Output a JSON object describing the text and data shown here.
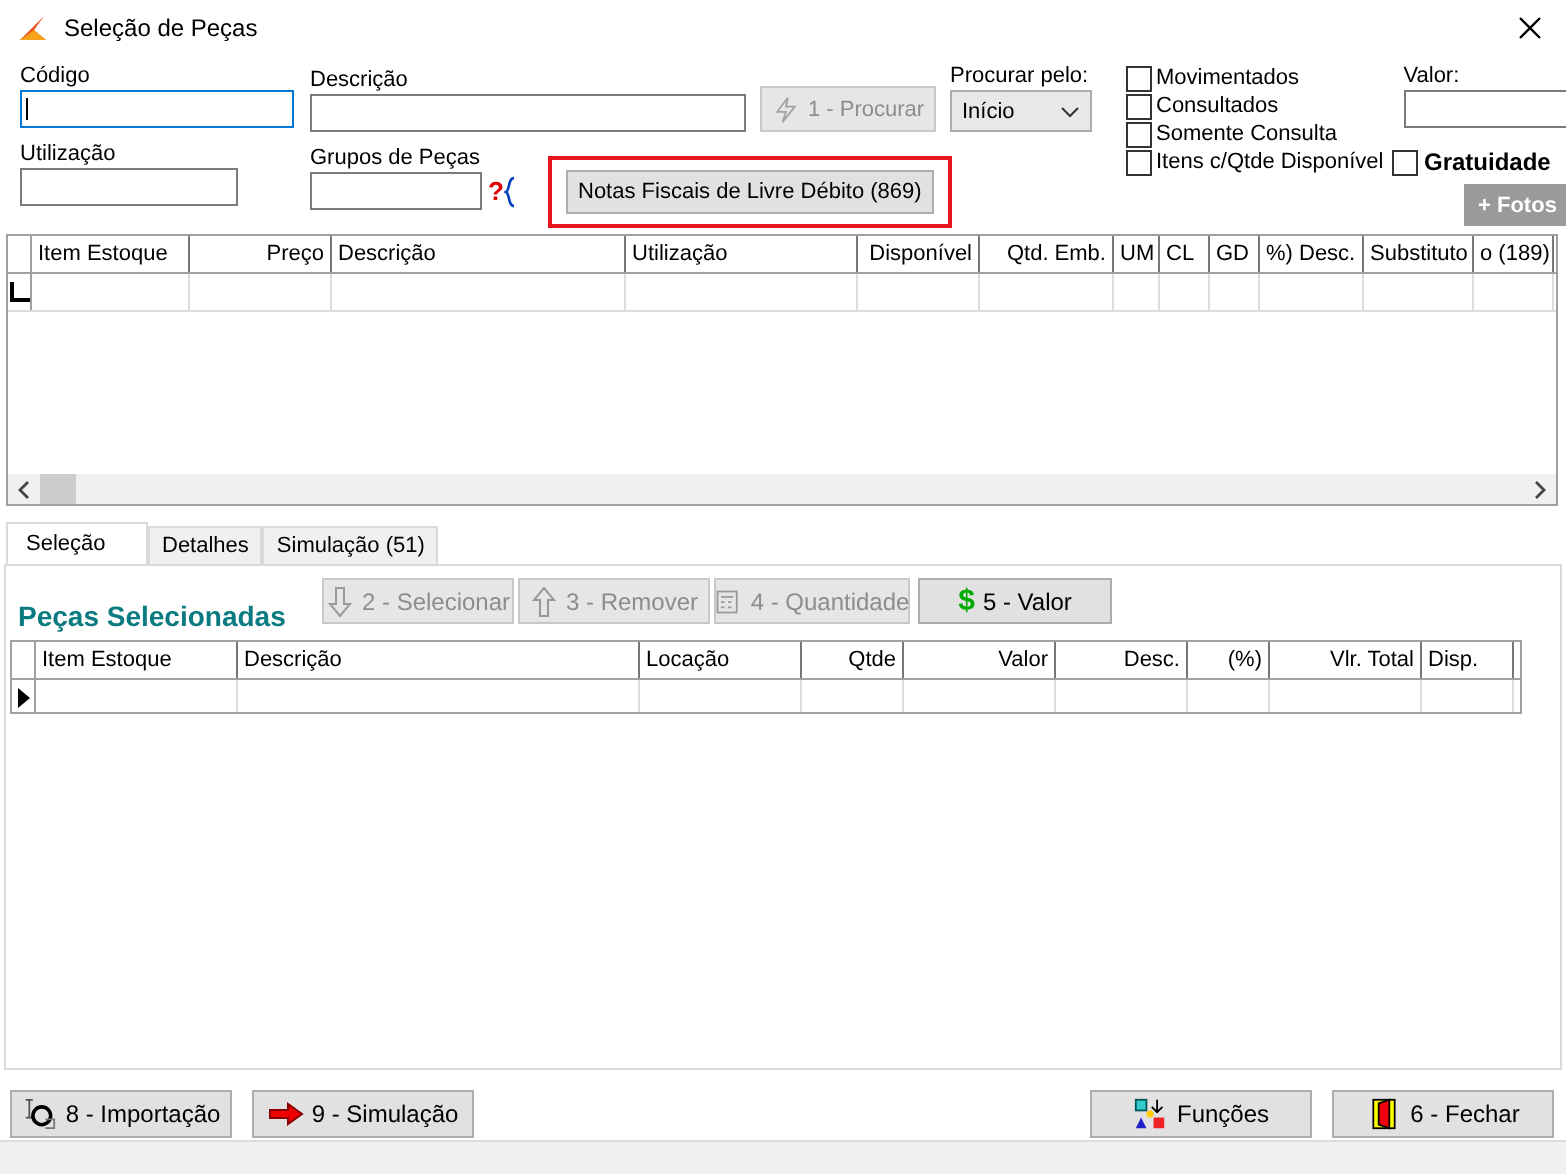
{
  "window": {
    "title": "Seleção de Peças"
  },
  "search": {
    "code": {
      "label": "Código",
      "focused": true
    },
    "description": {
      "label": "Descrição",
      "focused": false
    },
    "usage": {
      "label": "Utilização",
      "focused": false
    },
    "groups": {
      "label": "Grupos de Peças",
      "focused": false,
      "help_glyph": "?"
    },
    "search_button": {
      "label": "1 - Procurar",
      "disabled": true
    },
    "search_by": {
      "label": "Procurar pelo:",
      "value": "Início"
    },
    "filters": [
      {
        "label": "Movimentados",
        "checked": false
      },
      {
        "label": "Consultados",
        "checked": false
      },
      {
        "label": "Somente Consulta",
        "checked": false
      },
      {
        "label": "Itens c/Qtde Disponível",
        "checked": false
      }
    ],
    "value": {
      "label": "Valor:"
    },
    "free": {
      "label": "Gratuidade",
      "checked": false
    },
    "photos_button": {
      "label": "+ Fotos",
      "disabled": true
    },
    "invoices_button": {
      "label": "Notas Fiscais de Livre Débito (869)",
      "highlighted": true
    }
  },
  "parts_table": {
    "columns": [
      "Item Estoque",
      "Preço",
      "Descrição",
      "Utilização",
      "Disponível",
      "Qtd. Emb.",
      "UM",
      "CL",
      "GD",
      "%) Desc.",
      "Substituto",
      "o (189)"
    ]
  },
  "tabs": [
    {
      "label": "Seleção",
      "selected": true
    },
    {
      "label": "Detalhes",
      "selected": false
    },
    {
      "label": "Simulação (51)",
      "selected": false
    }
  ],
  "selected_section": {
    "title": "Peças Selecionadas",
    "buttons": [
      {
        "kind": "down",
        "label": "2 - Selecionar",
        "disabled": true
      },
      {
        "kind": "up",
        "label": "3 - Remover",
        "disabled": true
      },
      {
        "kind": "qty",
        "label": "4 - Quantidade",
        "disabled": true
      },
      {
        "kind": "money",
        "glyph": "$",
        "label": "5 - Valor",
        "disabled": false
      }
    ],
    "columns": [
      "Item Estoque",
      "Descrição",
      "Locação",
      "Qtde",
      "Valor",
      "Desc.",
      "(%)",
      "Vlr. Total",
      "Disp."
    ]
  },
  "footer_buttons": [
    {
      "kind": "import",
      "label": "8 - Importação"
    },
    {
      "kind": "sim",
      "label": "9 - Simulação"
    },
    {
      "kind": "functions",
      "label": "Funções"
    },
    {
      "kind": "close",
      "label": "6 - Fechar"
    }
  ]
}
